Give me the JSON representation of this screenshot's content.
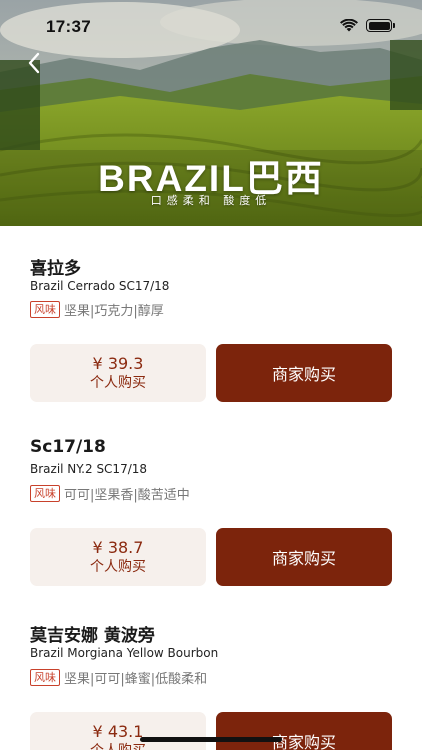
{
  "status_bar": {
    "time": "17:37"
  },
  "hero": {
    "title": "BRAZIL巴西",
    "subtitle": "口感柔和  酸度低"
  },
  "products": [
    {
      "name": "喜拉多",
      "english_name": "Brazil Cerrado SC17/18",
      "flavor_tag": "风味",
      "flavor_notes": "坚果|巧克力|醇厚",
      "price": "¥ 39.3",
      "price_label": "个人购买",
      "buy_label": "商家购买"
    },
    {
      "name": "Sc17/18",
      "english_name": "Brazil NY.2 SC17/18",
      "flavor_tag": "风味",
      "flavor_notes": "可可|坚果香|酸苦适中",
      "price": "¥ 38.7",
      "price_label": "个人购买",
      "buy_label": "商家购买"
    },
    {
      "name": "莫吉安娜 黄波旁",
      "english_name": "Brazil Morgiana Yellow Bourbon",
      "flavor_tag": "风味",
      "flavor_notes": "坚果|可可|蜂蜜|低酸柔和",
      "price": "¥ 43.1",
      "price_label": "个人购买",
      "buy_label": "商家购买"
    }
  ],
  "colors": {
    "accent": "#7c240c",
    "price_text": "#8b2a10",
    "price_bg": "#f6f0ec",
    "tag": "#c8412b"
  },
  "icons": [
    "back-chevron-icon",
    "wifi-icon",
    "battery-icon"
  ]
}
